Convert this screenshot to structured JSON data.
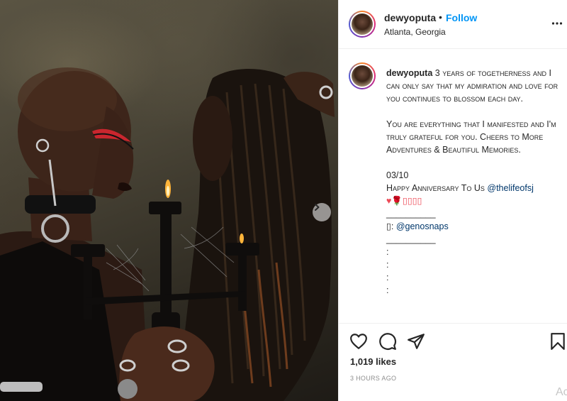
{
  "post": {
    "username": "dewyoputa",
    "follow_separator": "•",
    "follow_label": "Follow",
    "location": "Atlanta, Georgia",
    "caption": {
      "username": "dewyoputa",
      "paragraph1": "3 years of togetherness and I can only say that my admiration and love for you continues to blossom each day.",
      "paragraph2": "You are everything that I manifested and I'm truly grateful for you. Cheers to More Adventures & Beautiful Memories.",
      "date": "03/10",
      "anniversary": "Happy Anniversary To Us",
      "mention": "@thelifeofsj",
      "emojis": "♥🌹▯▯▯▯",
      "divider1": "__________",
      "credit_prefix": "▯:",
      "credit_mention": "@genosnaps",
      "divider2": "__________",
      "dots": [
        ":",
        ":",
        ":",
        ":"
      ]
    },
    "likes": "1,019 likes",
    "time": "3 HOURS AGO",
    "comment_placeholder": "Ac"
  },
  "icons": {
    "more": "more-horizontal-icon",
    "like": "heart-icon",
    "comment": "comment-icon",
    "share": "send-icon",
    "save": "bookmark-icon",
    "next": "chevron-right-icon"
  },
  "colors": {
    "follow": "#0095f6",
    "mention": "#00376b",
    "heart": "#ed4956",
    "muted": "#8e8e8e"
  }
}
